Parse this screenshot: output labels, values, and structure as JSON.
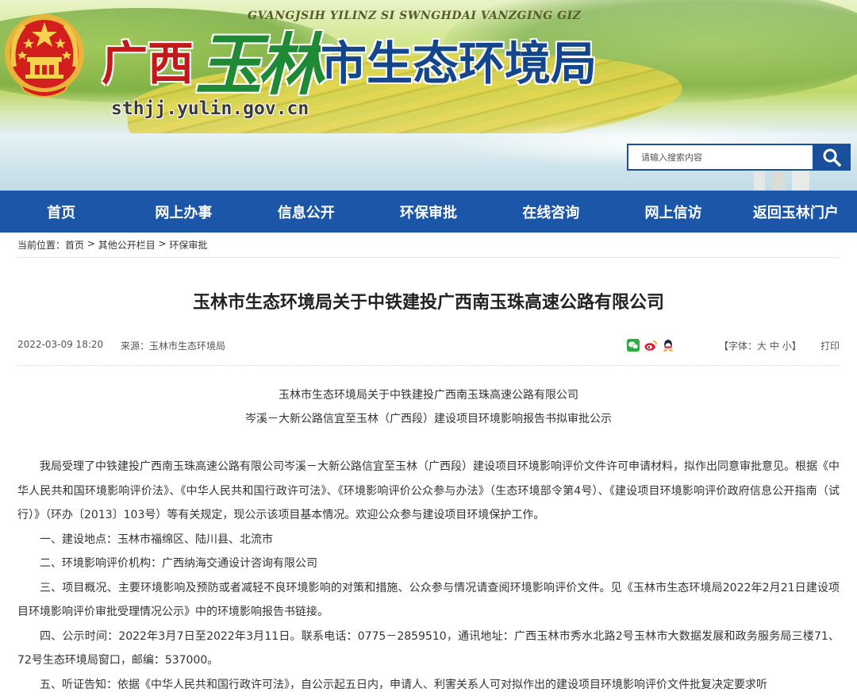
{
  "header": {
    "pinyin": "GVANGJSIH YILINZ SI SWNGHDAI VANZGING GIZ",
    "title_a": "广西",
    "title_b": "玉林",
    "title_c": "市生态环境局",
    "domain": "sthjj.yulin.gov.cn",
    "search": {
      "placeholder": "请输入搜索内容"
    },
    "icons": {
      "emblem": "national-emblem-icon",
      "search": "search-icon"
    }
  },
  "nav": {
    "items": [
      "首页",
      "网上办事",
      "信息公开",
      "环保审批",
      "在线咨询",
      "网上信访",
      "返回玉林门户"
    ]
  },
  "breadcrumb": {
    "label": "当前位置：",
    "items": [
      "首页",
      "其他公开栏目",
      "环保审批"
    ],
    "separator": " > "
  },
  "article": {
    "title": "玉林市生态环境局关于中铁建投广西南玉珠高速公路有限公司",
    "date": "2022-03-09 18:20",
    "source": "来源：玉林市生态环境局",
    "share_icons": [
      "wechat-icon",
      "weibo-icon",
      "qq-icon"
    ],
    "font_size": {
      "prefix": "【字体：",
      "large": "大",
      "medium": "中",
      "small": "小",
      "suffix": "】"
    },
    "print": "打印",
    "subtitle_1": "玉林市生态环境局关于中铁建投广西南玉珠高速公路有限公司",
    "subtitle_2": "岑溪－大新公路信宜至玉林（广西段）建设项目环境影响报告书拟审批公示",
    "paragraphs": [
      "我局受理了中铁建投广西南玉珠高速公路有限公司岑溪－大新公路信宜至玉林（广西段）建设项目环境影响评价文件许可申请材料，拟作出同意审批意见。根据《中华人民共和国环境影响评价法》、《中华人民共和国行政许可法》、《环境影响评价公众参与办法》（生态环境部令第4号）、《建设项目环境影响评价政府信息公开指南（试行）》（环办〔2013〕103号）等有关规定，现公示该项目基本情况。欢迎公众参与建设项目环境保护工作。",
      "一、建设地点：玉林市福绵区、陆川县、北流市",
      "二、环境影响评价机构：广西纳海交通设计咨询有限公司",
      "三、项目概况、主要环境影响及预防或者减轻不良环境影响的对策和措施、公众参与情况请查阅环境影响评价文件。见《玉林市生态环境局2022年2月21日建设项目环境影响评价审批受理情况公示》中的环境影响报告书链接。",
      "四、公示时间：2022年3月7日至2022年3月11日。联系电话：0775－2859510，通讯地址：广西玉林市秀水北路2号玉林市大数据发展和政务服务局三楼71、72号生态环境局窗口，邮编：537000。",
      "五、听证告知：依据《中华人民共和国行政许可法》，自公示起五日内，申请人、利害关系人可对拟作出的建设项目环境影响评价文件批复决定要求听"
    ]
  }
}
